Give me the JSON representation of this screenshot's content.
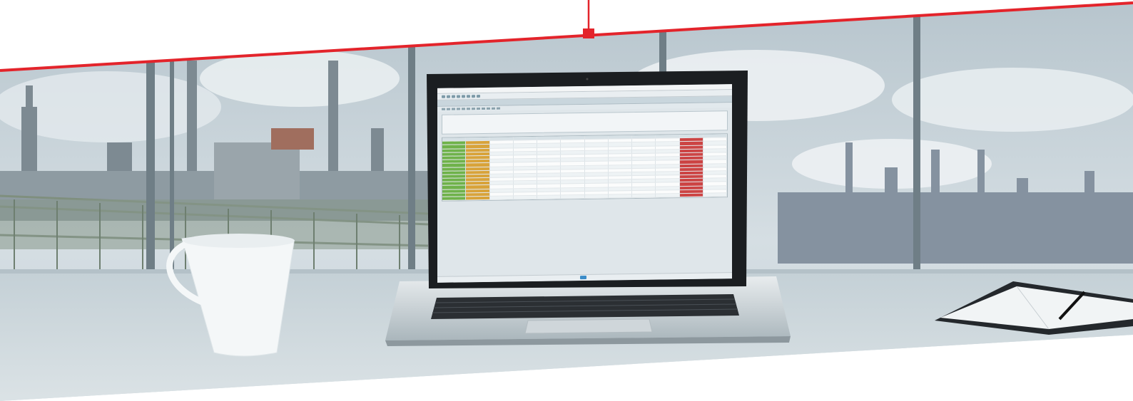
{
  "scene": {
    "colors": {
      "accent_line": "#e3242b",
      "sky_top": "#bfccd3",
      "sky_bottom": "#d7e0e4",
      "desk": "#c9d4d9",
      "laptop_body": "#dfe4e7",
      "screen_bezel": "#1b1e21",
      "mug": "#f3f6f7",
      "notebook": "#2a2d31"
    },
    "laptop_screen": {
      "menubar_items": [
        "",
        "",
        "",
        "",
        "",
        "",
        "",
        "",
        "",
        ""
      ],
      "title_text": ""
    }
  }
}
